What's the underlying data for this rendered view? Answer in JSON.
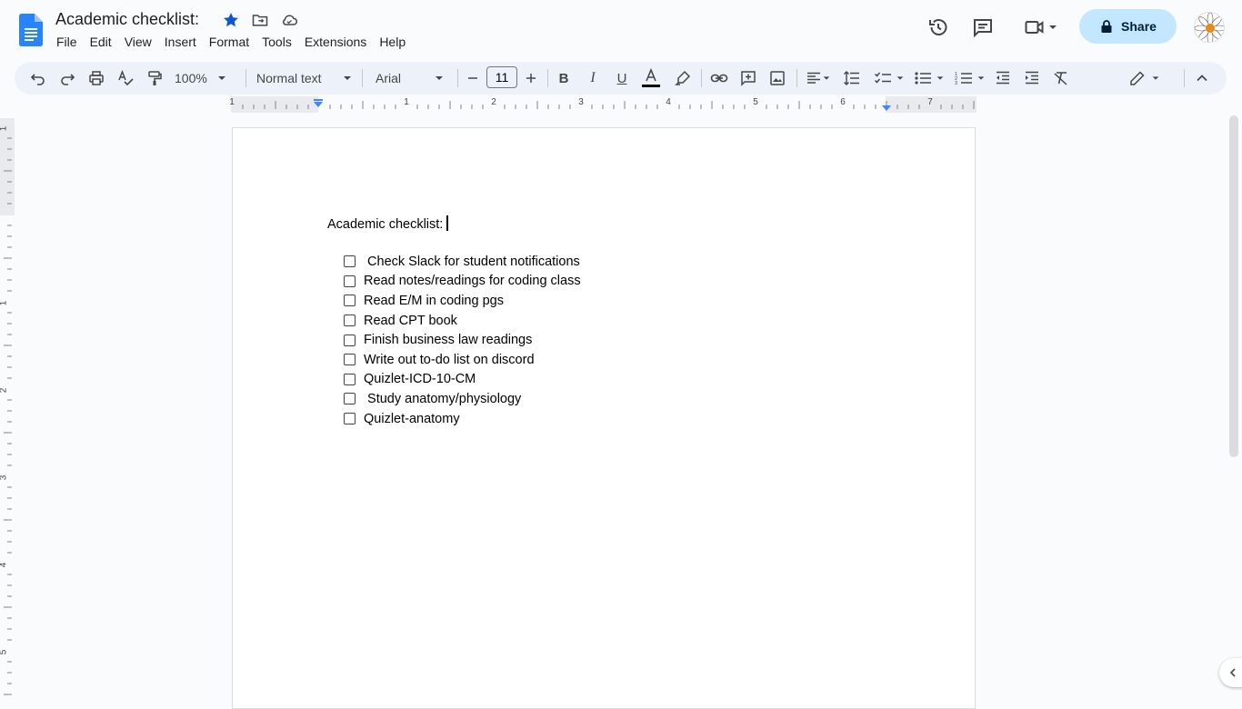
{
  "document": {
    "title": "Academic checklist:",
    "heading": "Academic checklist:",
    "checklist": [
      {
        "text": " Check Slack for student notifications",
        "checked": false
      },
      {
        "text": "Read notes/readings for coding class",
        "checked": false
      },
      {
        "text": "Read E/M in coding pgs",
        "checked": false
      },
      {
        "text": "Read CPT book",
        "checked": false
      },
      {
        "text": "Finish business law readings",
        "checked": false
      },
      {
        "text": "Write out to-do list on discord",
        "checked": false
      },
      {
        "text": "Quizlet-ICD-10-CM",
        "checked": false
      },
      {
        "text": " Study anatomy/physiology",
        "checked": false
      },
      {
        "text": "Quizlet-anatomy",
        "checked": false
      }
    ]
  },
  "menu": [
    "File",
    "Edit",
    "View",
    "Insert",
    "Format",
    "Tools",
    "Extensions",
    "Help"
  ],
  "header": {
    "share_label": "Share"
  },
  "toolbar": {
    "zoom": "100%",
    "style": "Normal text",
    "font": "Arial",
    "font_size": "11"
  },
  "ruler": {
    "h_labels": [
      "1",
      "1",
      "2",
      "3",
      "4",
      "5",
      "6",
      "7"
    ],
    "v_labels": [
      "1",
      "1",
      "2",
      "3",
      "4",
      "5"
    ]
  },
  "colors": {
    "accent": "#0b57d0",
    "share_bg": "#c2e7ff",
    "toolbar_bg": "#edf2fa",
    "app_bg": "#f9fbfd"
  }
}
